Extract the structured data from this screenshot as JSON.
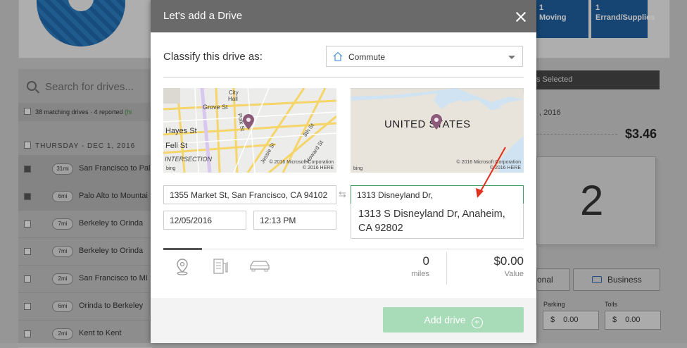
{
  "background": {
    "tiles": [
      {
        "count": "1",
        "label": "Moving"
      },
      {
        "count": "1",
        "label": "Errand/Supplies"
      }
    ],
    "search_placeholder": "Search for drives...",
    "matching": "38 matching drives · 4 reported",
    "matching_extra": "(hi",
    "day_header": "THURSDAY - DEC 1, 2016",
    "drives": [
      {
        "dist": "31mi",
        "name": "San Francisco to Pal",
        "checked": true
      },
      {
        "dist": "6mi",
        "name": "Palo Alto to Mountai",
        "checked": true
      },
      {
        "dist": "7mi",
        "name": "Berkeley to Orinda",
        "checked": false
      },
      {
        "dist": "7mi",
        "name": "Berkeley to Orinda",
        "checked": false
      },
      {
        "dist": "2mi",
        "name": "San Francisco to MI",
        "checked": false
      },
      {
        "dist": "6mi",
        "name": "Orinda to Berkeley",
        "checked": false
      },
      {
        "dist": "2mi",
        "name": "Kent to Kent",
        "checked": false
      }
    ],
    "selected_bar": "s Selected",
    "right_date": ", 2016",
    "right_price": "$3.46",
    "right_count": "2",
    "personal_label": "onal",
    "business_label": "Business",
    "parking_label": "Parking",
    "tolls_label": "Tolls",
    "currency": "$",
    "parking_value": "0.00",
    "tolls_value": "0.00"
  },
  "modal": {
    "title": "Let's add a Drive",
    "classify_label": "Classify this drive as:",
    "classify_value": "Commute",
    "map1": {
      "labels": [
        "City",
        "Hall",
        "Grove St",
        "Hayes St",
        "Fell St",
        "Polk St",
        "8th St",
        "Jessie St",
        "Howard St",
        "INTERSECTION"
      ],
      "copyright": "© 2016 Microsoft Corporation",
      "copyright2": "© 2016 HERE",
      "bing": "bing"
    },
    "map2": {
      "country": "UNITED STATES",
      "copyright": "© 2016 Microsoft Corporation",
      "copyright2": "© 2016 HERE",
      "bing": "bing"
    },
    "from_address": "1355 Market St, San Francisco, CA 94102",
    "to_address": "1313 Disneyland Dr,",
    "suggestion": "1313 S Disneyland Dr, Anaheim, CA 92802",
    "date": "12/05/2016",
    "time": "12:13 PM",
    "miles_value": "0",
    "miles_label": "miles",
    "value_amount": "$0.00",
    "value_label": "Value",
    "add_button": "Add drive",
    "colors": {
      "header": "#6a6a6a",
      "add_button": "#a8dcb8",
      "focus_border": "#3a9a5a",
      "arrow": "#e0301e",
      "pin": "#8a5a78"
    }
  }
}
